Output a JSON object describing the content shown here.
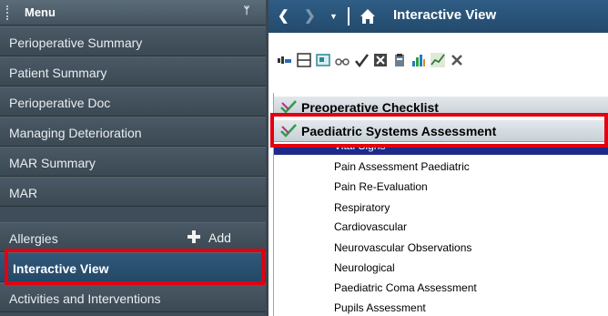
{
  "menu": {
    "title": "Menu",
    "pin_icon": "pin-icon",
    "items": [
      {
        "label": "Perioperative Summary"
      },
      {
        "label": "Patient Summary"
      },
      {
        "label": "Perioperative Doc"
      },
      {
        "label": "Managing Deterioration"
      },
      {
        "label": "MAR Summary"
      },
      {
        "label": "MAR"
      },
      {
        "label": "Allergies",
        "action_label": "Add",
        "action_icon": "plus-icon"
      },
      {
        "label": "Interactive View",
        "active": true
      },
      {
        "label": "Activities and Interventions"
      }
    ]
  },
  "header": {
    "title": "Interactive View",
    "nav_icons": [
      "back-icon",
      "forward-icon",
      "history-dropdown-icon",
      "home-icon"
    ]
  },
  "toolbar": {
    "icons": [
      "band-icon",
      "grid-icon",
      "insert-icon",
      "glasses-icon",
      "checkmark-icon",
      "unchart-icon",
      "clipboard-icon",
      "bar-chart-icon",
      "line-chart-icon",
      "close-icon"
    ]
  },
  "sections": [
    {
      "label": "Preoperative Checklist"
    },
    {
      "label": "Paediatric Systems Assessment"
    }
  ],
  "subitems": {
    "selected": "Vital Signs",
    "list": [
      "Pain Assessment Paediatric",
      "Pain Re-Evaluation",
      "Respiratory",
      "Cardiovascular",
      "Neurovascular Observations",
      "Neurological",
      "Paediatric Coma Assessment",
      "Pupils Assessment"
    ]
  },
  "colors": {
    "menu_bg": "#3e4d59",
    "active_item": "#2a4f70",
    "topbar": "#2a5479",
    "selected_row": "#1e2a8a",
    "highlight": "#e3000f"
  }
}
